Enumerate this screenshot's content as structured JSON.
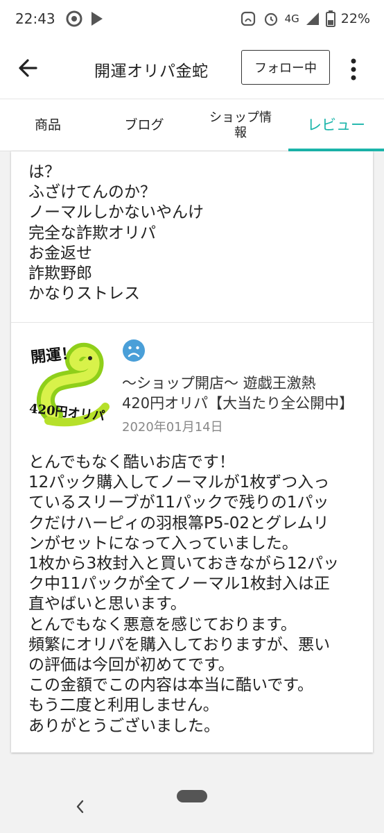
{
  "status_bar": {
    "time": "22:43",
    "network": "4G",
    "battery": "22%"
  },
  "app_bar": {
    "title": "開運オリパ金蛇",
    "follow_label": "フォロー中"
  },
  "tabs": [
    {
      "label": "商品"
    },
    {
      "label": "ブログ"
    },
    {
      "label": "ショップ情\n報"
    },
    {
      "label": "レビュー"
    }
  ],
  "accent_color": "#1bb5aa",
  "reviews": [
    {
      "lines": "は？\nふざけてんのか？\nノーマルしかないやんけ\n完全な詐欺オリパ\nお金返せ\n詐欺野郎\nかなりストレス"
    },
    {
      "thumbnail_text_top": "開運！",
      "thumbnail_text_bottom": "420円オリパ",
      "rating_icon": "sad-face-icon",
      "product_title_line1": "〜ショップ開店〜 遊戯王激熱",
      "product_title_line2": "420円オリパ【大当たり全公開中】",
      "date": "2020年01月14日",
      "lines": "とんでもなく酷いお店です！\n12パック購入してノーマルが1枚ずつ入っ\nているスリーブが11パックで残りの1パッ\nクだけハーピィの羽根箒P5-02とグレムリ\nンがセットになって入っていました。\n1枚から3枚封入と買いておきながら12パッ\nク中11パックが全てノーマル1枚封入は正\n直やばいと思います。\nとんでもなく悪意を感じております。\n頻繁にオリパを購入しておりますが、悪い\nの評価は今回が初めてです。\nこの金額でこの内容は本当に酷いです。\nもう二度と利用しません。\nありがとうございました。"
    }
  ]
}
